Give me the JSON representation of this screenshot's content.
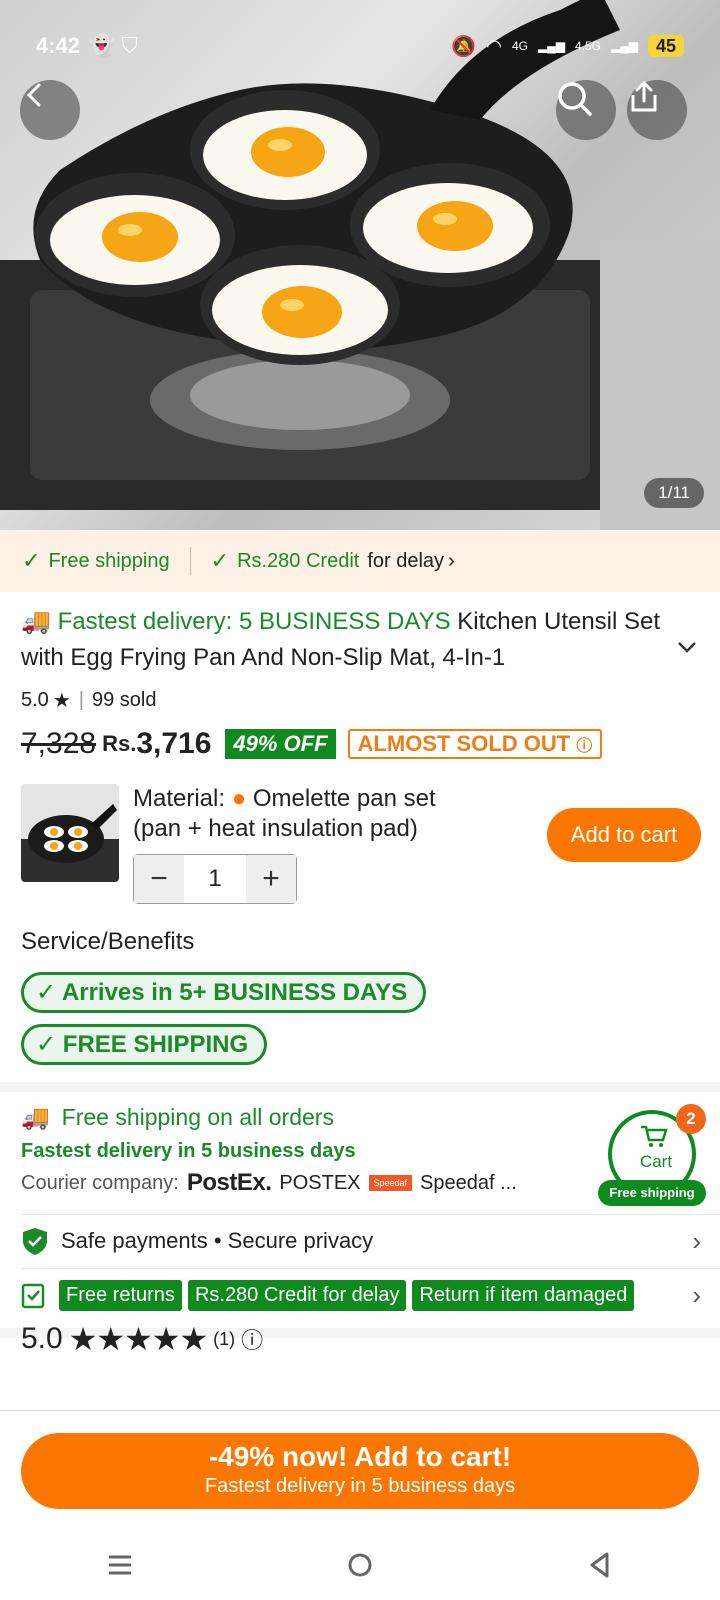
{
  "status_bar": {
    "time": "4:42",
    "network_1": "4G",
    "network_2": "4.5G",
    "battery": "45"
  },
  "gallery": {
    "counter": "1/11"
  },
  "benefit_strip": {
    "free_shipping": "Free shipping",
    "credit_highlight": "Rs.280 Credit",
    "credit_suffix": "for delay"
  },
  "product": {
    "fastest_label": "Fastest delivery: 5 BUSINESS DAYS",
    "title": "Kitchen Utensil Set with Egg Frying Pan And Non-Slip Mat, 4-In-1",
    "rating": "5.0",
    "sold": "99 sold",
    "old_price": "7,328",
    "currency": "Rs.",
    "price": "3,716",
    "discount": "49% OFF",
    "stock_badge": "ALMOST SOLD OUT"
  },
  "variant": {
    "label": "Material:",
    "value_line1": "Omelette pan set",
    "value_line2": "(pan + heat insulation pad)",
    "quantity": "1",
    "add_to_cart": "Add to cart"
  },
  "services": {
    "title": "Service/Benefits",
    "pills": [
      "Arrives in 5+ BUSINESS DAYS",
      "FREE SHIPPING"
    ]
  },
  "shipping": {
    "line1": "Free shipping on all orders",
    "line2": "Fastest delivery in 5 business days",
    "courier_label": "Courier company:",
    "courier_logo": "PostEx.",
    "courier_1": "POSTEX",
    "speedaf_logo": "Speedaf",
    "courier_2": "Speedaf ..."
  },
  "cart_float": {
    "label": "Cart",
    "badge": "2",
    "ship": "Free shipping"
  },
  "safe": {
    "text": "Safe payments • Secure privacy"
  },
  "tags": [
    "Free returns",
    "Rs.280 Credit for delay",
    "Return if item damaged"
  ],
  "reviews": {
    "score": "5.0",
    "stars": "★★★★★",
    "count": "(1)"
  },
  "cta": {
    "line1": "-49% now! Add to cart!",
    "line2": "Fastest delivery in 5 business days"
  },
  "colors": {
    "accent_orange": "#fb7701",
    "green": "#1b8a2a",
    "strip_bg": "#fdf0e5"
  }
}
